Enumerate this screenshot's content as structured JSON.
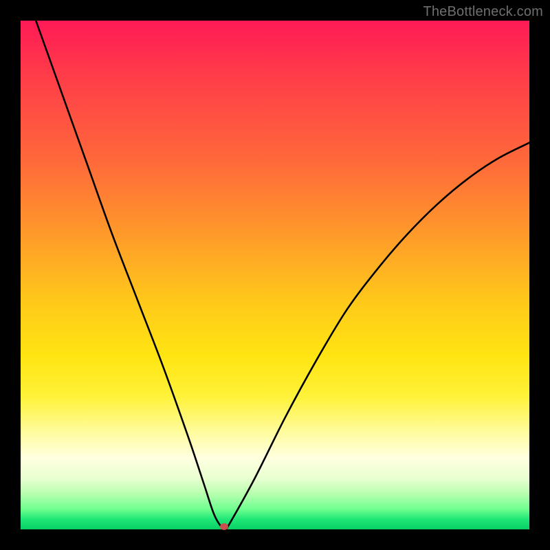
{
  "watermark": "TheBottleneck.com",
  "chart_data": {
    "type": "line",
    "title": "",
    "xlabel": "",
    "ylabel": "",
    "xlim": [
      0,
      100
    ],
    "ylim": [
      0,
      100
    ],
    "grid": false,
    "legend": false,
    "series": [
      {
        "name": "curve",
        "x": [
          3,
          8,
          13,
          18,
          23,
          28,
          33,
          36,
          38,
          39.5,
          40.5,
          41,
          46,
          52,
          58,
          64,
          70,
          76,
          82,
          88,
          94,
          100
        ],
        "y": [
          100,
          86,
          72,
          58,
          45,
          32,
          18,
          9,
          3,
          0.5,
          0.5,
          1,
          10,
          22,
          33,
          43,
          51,
          58,
          64,
          69,
          73,
          76
        ]
      }
    ],
    "marker": {
      "x": 40,
      "y": 0.5,
      "color": "#c94f4f"
    },
    "background_gradient": {
      "stops": [
        {
          "pos": 0,
          "color": "#ff1a56"
        },
        {
          "pos": 10,
          "color": "#ff3a4a"
        },
        {
          "pos": 28,
          "color": "#ff6a3a"
        },
        {
          "pos": 42,
          "color": "#ff9a2a"
        },
        {
          "pos": 55,
          "color": "#ffc81a"
        },
        {
          "pos": 66,
          "color": "#ffe512"
        },
        {
          "pos": 74,
          "color": "#fff23a"
        },
        {
          "pos": 81,
          "color": "#fffca0"
        },
        {
          "pos": 86,
          "color": "#ffffe0"
        },
        {
          "pos": 90,
          "color": "#e8ffd0"
        },
        {
          "pos": 93,
          "color": "#b8ffb0"
        },
        {
          "pos": 96,
          "color": "#70ff90"
        },
        {
          "pos": 98,
          "color": "#20e776"
        },
        {
          "pos": 100,
          "color": "#08d066"
        }
      ]
    }
  }
}
